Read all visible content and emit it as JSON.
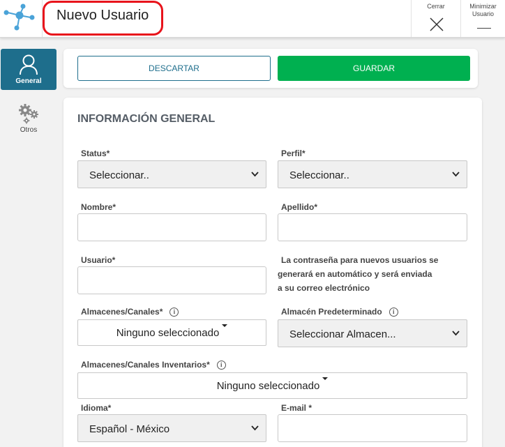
{
  "header": {
    "title": "Nuevo Usuario",
    "close_label": "Cerrar",
    "minimize_label": "Minimizar Usuario"
  },
  "sidebar": {
    "items": [
      {
        "label": "General",
        "icon": "user-icon",
        "active": true
      },
      {
        "label": "Otros",
        "icon": "gears-icon",
        "active": false
      }
    ]
  },
  "actions": {
    "discard_label": "DESCARTAR",
    "save_label": "GUARDAR"
  },
  "form": {
    "section_title": "INFORMACIÓN GENERAL",
    "status": {
      "label": "Status*",
      "value": "Seleccionar.."
    },
    "perfil": {
      "label": "Perfil*",
      "value": "Seleccionar.."
    },
    "nombre": {
      "label": "Nombre*",
      "value": ""
    },
    "apellido": {
      "label": "Apellido*",
      "value": ""
    },
    "usuario": {
      "label": "Usuario*",
      "value": ""
    },
    "password_note": {
      "line1": "La contraseña para nuevos usuarios se",
      "line2": "generará en automático y será enviada",
      "line3": "a su correo electrónico"
    },
    "almacenes": {
      "label": "Almacenes/Canales*",
      "value": "Ninguno seleccionado"
    },
    "almacen_pred": {
      "label": "Almacén Predeterminado",
      "value": "Seleccionar Almacen..."
    },
    "almacenes_inv": {
      "label": "Almacenes/Canales Inventarios*",
      "value": "Ninguno seleccionado"
    },
    "idioma": {
      "label": "Idioma*",
      "value": "Español - México"
    },
    "email": {
      "label": "E-mail *",
      "value": ""
    }
  },
  "colors": {
    "brand": "#1e6e8c",
    "save": "#00b050",
    "highlight": "#e8131b",
    "logo": "#4aa3d8"
  }
}
